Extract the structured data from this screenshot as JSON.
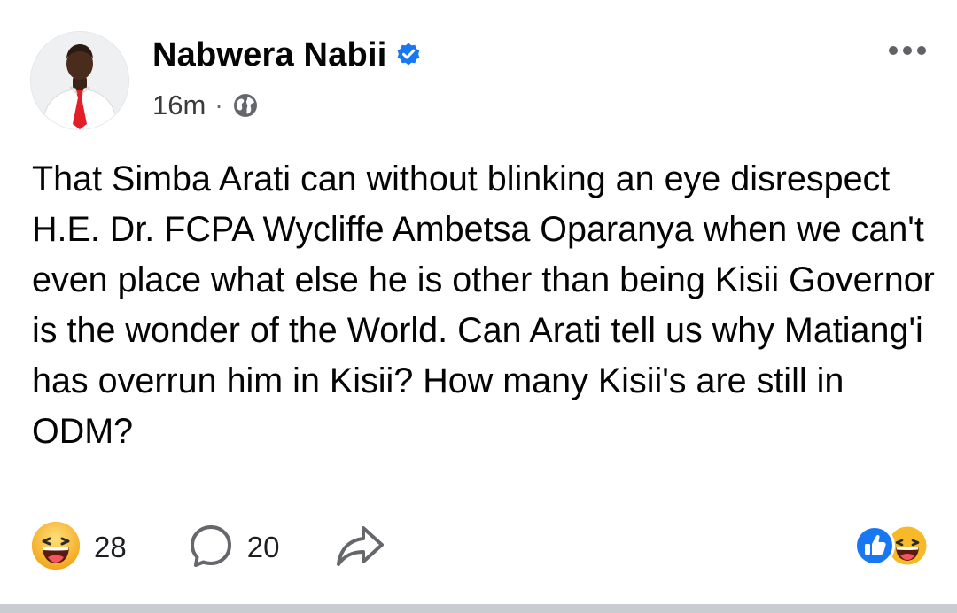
{
  "post": {
    "author": {
      "name": "Nabwera Nabii",
      "verified": true,
      "avatar_icon": "profile-photo"
    },
    "timestamp": "16m",
    "separator": "·",
    "audience_icon": "globe-icon",
    "text": "That Simba Arati can without blinking an eye disrespect H.E. Dr. FCPA Wycliffe Ambetsa Oparanya when we can't even place what else he is other than being Kisii Governor is the wonder of the World. Can Arati tell us why Matiang'i has overrun him in Kisii? How many Kisii's are still in ODM?"
  },
  "actions": {
    "reaction_icon": "haha-emoji-icon",
    "reaction_count": "28",
    "comment_icon": "comment-icon",
    "comment_count": "20",
    "share_icon": "share-icon"
  },
  "reaction_summary": {
    "icons": [
      "like-icon",
      "haha-emoji-icon"
    ]
  },
  "colors": {
    "verified_blue": "#1877f2",
    "like_blue": "#1877f2",
    "haha_yellow": "#f7b928",
    "icon_grey": "#65676b"
  }
}
